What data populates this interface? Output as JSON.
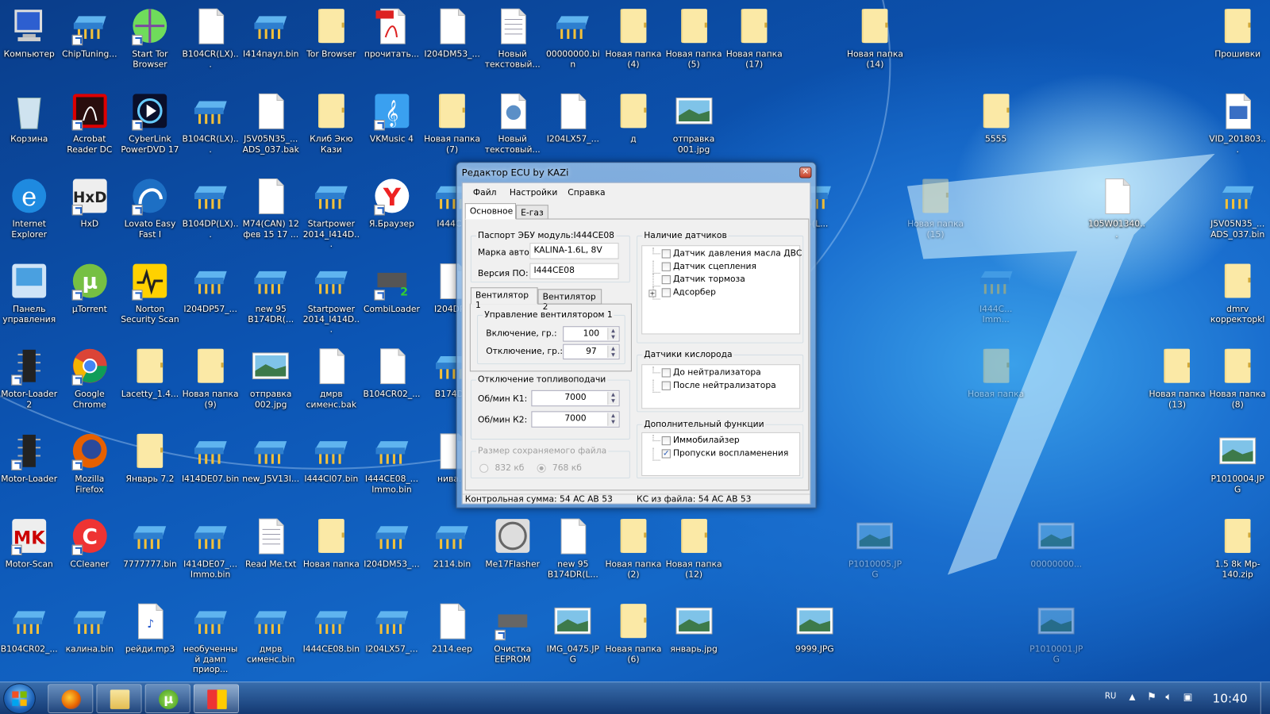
{
  "desktop": {
    "icons": [
      {
        "label": "Компьютер",
        "type": "computer"
      },
      {
        "label": "ChipTuning...",
        "type": "chip",
        "shortcut": true
      },
      {
        "label": "Start Tor Browser",
        "type": "tor",
        "shortcut": true
      },
      {
        "label": "B104CR(LX)...",
        "type": "file"
      },
      {
        "label": "I414паул.bin",
        "type": "chip"
      },
      {
        "label": "Tor Browser",
        "type": "folder"
      },
      {
        "label": "прочитать...",
        "type": "pdf"
      },
      {
        "label": "I204DM53_...",
        "type": "file"
      },
      {
        "label": "Новый текстовый...",
        "type": "txt"
      },
      {
        "label": "00000000.bin",
        "type": "chip"
      },
      {
        "label": "Новая папка (4)",
        "type": "folder"
      },
      {
        "label": "Новая папка (5)",
        "type": "folder"
      },
      {
        "label": "Новая папка (17)",
        "type": "folder"
      },
      {
        "label": "Новая папка (14)",
        "type": "folder"
      },
      {
        "label": "Прошивки",
        "type": "folder"
      },
      {
        "label": "Корзина",
        "type": "recycle"
      },
      {
        "label": "Acrobat Reader DC",
        "type": "acrobat",
        "shortcut": true
      },
      {
        "label": "CyberLink PowerDVD 17",
        "type": "dvd",
        "shortcut": true
      },
      {
        "label": "B104CR(LX)...",
        "type": "chip"
      },
      {
        "label": "J5V05N35_... ADS_037.bak",
        "type": "file"
      },
      {
        "label": "Клиб Экю Кази",
        "type": "folder"
      },
      {
        "label": "VKMusic 4",
        "type": "vkmusic",
        "shortcut": true
      },
      {
        "label": "Новая папка (7)",
        "type": "folder"
      },
      {
        "label": "Новый текстовый...",
        "type": "settingsdoc"
      },
      {
        "label": "I204LX57_...",
        "type": "file"
      },
      {
        "label": "д",
        "type": "folder"
      },
      {
        "label": "отправка 001.jpg",
        "type": "image"
      },
      {
        "label": "5555",
        "type": "folder"
      },
      {
        "label": "VID_201803...",
        "type": "video"
      },
      {
        "label": "Internet Explorer",
        "type": "ie"
      },
      {
        "label": "HxD",
        "type": "hxd",
        "shortcut": true
      },
      {
        "label": "Lovato Easy Fast I",
        "type": "lovato",
        "shortcut": true
      },
      {
        "label": "B104DP(LX)...",
        "type": "chip"
      },
      {
        "label": "M74(CAN) 12 фев 15 17 ...",
        "type": "file"
      },
      {
        "label": "Startpower 2014_I414D...",
        "type": "chip"
      },
      {
        "label": "Я.Браузер",
        "type": "yandex",
        "shortcut": true
      },
      {
        "label": "I444CI(",
        "type": "chip"
      },
      {
        "label": "35(L...",
        "type": "chip"
      },
      {
        "label": "Новая папка (15)",
        "type": "folder",
        "faded": true
      },
      {
        "label": "105W01340...",
        "type": "file"
      },
      {
        "label": "J5V05N35_... ADS_037.bin",
        "type": "chip"
      },
      {
        "label": "Панель управления",
        "type": "control"
      },
      {
        "label": "µTorrent",
        "type": "utorrent",
        "shortcut": true
      },
      {
        "label": "Norton Security Scan",
        "type": "norton",
        "shortcut": true
      },
      {
        "label": "I204DP57_...",
        "type": "chip"
      },
      {
        "label": "new 95 B174DR(...",
        "type": "chip"
      },
      {
        "label": "Startpower 2014_I414D...",
        "type": "chip"
      },
      {
        "label": "CombiLoader",
        "type": "combiloader",
        "shortcut": true
      },
      {
        "label": "I204DP5",
        "type": "file"
      },
      {
        "label": "I444C... Imm...",
        "type": "chip",
        "faded": true
      },
      {
        "label": "dmrv корректорkl",
        "type": "folder"
      },
      {
        "label": "Motor-Loader 2",
        "type": "mcu",
        "shortcut": true
      },
      {
        "label": "Google Chrome",
        "type": "chrome",
        "shortcut": true
      },
      {
        "label": "Lacetty_1.4...",
        "type": "folder"
      },
      {
        "label": "Новая папка (9)",
        "type": "folder"
      },
      {
        "label": "отправка 002.jpg",
        "type": "image"
      },
      {
        "label": "дмрв сименс.bak",
        "type": "file"
      },
      {
        "label": "B104CR02_...",
        "type": "file"
      },
      {
        "label": "B174DR",
        "type": "chip"
      },
      {
        "label": "Новая папка",
        "type": "folder",
        "faded": true
      },
      {
        "label": "Новая папка (13)",
        "type": "folder"
      },
      {
        "label": "Новая папка (8)",
        "type": "folder"
      },
      {
        "label": "Motor-Loader",
        "type": "mcu",
        "shortcut": true
      },
      {
        "label": "Mozilla Firefox",
        "type": "firefox",
        "shortcut": true
      },
      {
        "label": "Январь 7.2",
        "type": "folder"
      },
      {
        "label": "I414DE07.bin",
        "type": "chip"
      },
      {
        "label": "new_J5V13I...",
        "type": "chip"
      },
      {
        "label": "I444CI07.bin",
        "type": "chip"
      },
      {
        "label": "I444CE08_... Immo.bin",
        "type": "chip"
      },
      {
        "label": "нива...",
        "type": "file"
      },
      {
        "label": "P1010004.JPG",
        "type": "image"
      },
      {
        "label": "Motor-Scan",
        "type": "motorscan",
        "shortcut": true
      },
      {
        "label": "CCleaner",
        "type": "ccleaner",
        "shortcut": true
      },
      {
        "label": "7777777.bin",
        "type": "chip"
      },
      {
        "label": "I414DE07_... Immo.bin",
        "type": "chip"
      },
      {
        "label": "Read Me.txt",
        "type": "txt"
      },
      {
        "label": "Новая папка",
        "type": "folder"
      },
      {
        "label": "I204DM53_...",
        "type": "chip"
      },
      {
        "label": "2114.bin",
        "type": "chip"
      },
      {
        "label": "Me17Flasher",
        "type": "me17"
      },
      {
        "label": "new 95 B174DR(L...",
        "type": "file"
      },
      {
        "label": "Новая папка (2)",
        "type": "folder"
      },
      {
        "label": "Новая папка (12)",
        "type": "folder"
      },
      {
        "label": "P1010005.JPG",
        "type": "image",
        "faded": true
      },
      {
        "label": "00000000...",
        "type": "image",
        "faded": true
      },
      {
        "label": "1.5 8k Mp-140.zip",
        "type": "zip"
      },
      {
        "label": "B104CR02_...",
        "type": "chip"
      },
      {
        "label": "калина.bin",
        "type": "chip"
      },
      {
        "label": "рейди.mp3",
        "type": "mp3"
      },
      {
        "label": "необученный дамп приор...",
        "type": "chip"
      },
      {
        "label": "дмрв сименс.bin",
        "type": "chip"
      },
      {
        "label": "I444CE08.bin",
        "type": "chip"
      },
      {
        "label": "I204LX57_...",
        "type": "chip"
      },
      {
        "label": "2114.eep",
        "type": "file"
      },
      {
        "label": "Очистка EEPROM",
        "type": "eeprom",
        "shortcut": true
      },
      {
        "label": "IMG_0475.JPG",
        "type": "image"
      },
      {
        "label": "Новая папка (6)",
        "type": "folder"
      },
      {
        "label": "январь.jpg",
        "type": "image"
      },
      {
        "label": "9999.JPG",
        "type": "image"
      },
      {
        "label": "P1010001.JPG",
        "type": "image",
        "faded": true
      }
    ]
  },
  "dialog": {
    "title": "Редактор ECU by  KAZi",
    "close": "✕",
    "menu": [
      "Файл",
      "Настройки",
      "Справка"
    ],
    "tabs": [
      "Основное",
      "E-газ"
    ],
    "passport": {
      "caption": "Паспорт ЭБУ модуль:I444CE08",
      "car_label": "Марка авто:",
      "car_value": "KALINA-1.6L, 8V",
      "fw_label": "Версия ПО:",
      "fw_value": "I444CE08"
    },
    "fan_tabs": [
      "Вентилятор 1",
      "Вентилятор 2"
    ],
    "fan": {
      "caption": "Управление вентилятором 1",
      "on_label": "Включение, гр.:",
      "on_value": "100",
      "off_label": "Отключение, гр.:",
      "off_value": "97"
    },
    "fuel_cut": {
      "caption": "Отключение топливоподачи",
      "k1_label": "Об/мин К1:",
      "k1_value": "7000",
      "k2_label": "Об/мин К2:",
      "k2_value": "7000"
    },
    "file_size": {
      "caption": "Размер сохраняемого файла",
      "options": [
        "832 кб",
        "768 кб"
      ],
      "selected": "768 кб",
      "disabled": true
    },
    "sensors": {
      "caption": "Наличие датчиков",
      "items": [
        {
          "label": "Датчик давления масла ДВС",
          "checked": false
        },
        {
          "label": "Датчик сцепления",
          "checked": false
        },
        {
          "label": "Датчик тормоза",
          "checked": false
        },
        {
          "label": "Адсорбер",
          "checked": false,
          "expandable": true
        }
      ]
    },
    "oxygen": {
      "caption": "Датчики кислорода",
      "items": [
        {
          "label": "До нейтрализатора",
          "checked": false
        },
        {
          "label": "После нейтрализатора",
          "checked": false
        }
      ]
    },
    "extra": {
      "caption": "Дополнительный функции",
      "items": [
        {
          "label": "Иммобилайзер",
          "checked": false
        },
        {
          "label": "Пропуски воспламенения",
          "checked": true
        }
      ]
    },
    "status": {
      "checksum": "Контрольная сумма: 54 AC AB 53",
      "file_checksum": "КС из файла: 54 AC AB 53"
    }
  },
  "taskbar": {
    "apps": [
      "firefox",
      "explorer",
      "utorrent",
      "ecu-editor"
    ],
    "active": "ecu-editor",
    "lang": "RU",
    "clock": "10:40"
  }
}
